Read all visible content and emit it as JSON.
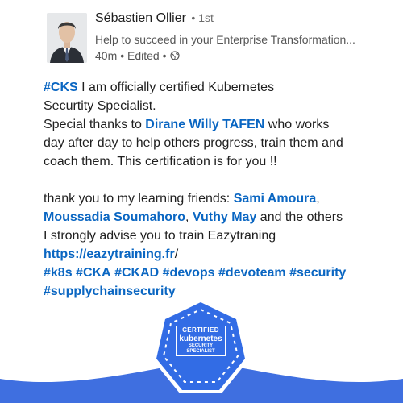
{
  "author": {
    "name": "Sébastien Ollier",
    "degree": "• 1st",
    "headline": "Help to succeed in your Enterprise Transformation...",
    "time": "40m",
    "edited": "• Edited •",
    "avatar_icon": "profile-photo",
    "globe_icon": "globe-icon"
  },
  "post": {
    "hashtag_cks": "#CKS",
    "line1_rest": " I am officially certified Kubernetes",
    "line2": "Securtity Specialist.",
    "line3_a": "Special thanks to ",
    "mention_dirane": "Dirane Willy TAFEN",
    "line3_b": " who works",
    "line4": "day after day to help others progress, train them and",
    "line5": "coach them. This certification is for you !!",
    "line6_a": "thank you to my learning friends: ",
    "mention_sami": "Sami Amoura",
    "line6_b": ",",
    "mention_moussadia": "Moussadia Soumahoro",
    "line7_b": ", ",
    "mention_vuthy": "Vuthy May",
    "line7_c": " and the others",
    "line8": "I strongly advise you to train Eazytraning",
    "link_url": "https://eazytraining.fr",
    "link_slash": "/",
    "hashtags_line": [
      {
        "text": "#k8s"
      },
      {
        "text": "#CKA"
      },
      {
        "text": "#CKAD"
      },
      {
        "text": "#devops"
      },
      {
        "text": "#devoteam"
      },
      {
        "text": "#security"
      }
    ],
    "hashtag_supply": "#supplychainsecurity"
  },
  "badge": {
    "line1": "CERTIFIED",
    "line2": "kubernetes",
    "line3": "SECURITY",
    "line4": "SPECIALIST",
    "color": "#326ce5"
  },
  "colors": {
    "link": "#0a66c2",
    "badge_blue": "#326ce5",
    "wave_blue": "#3f6fe0"
  }
}
